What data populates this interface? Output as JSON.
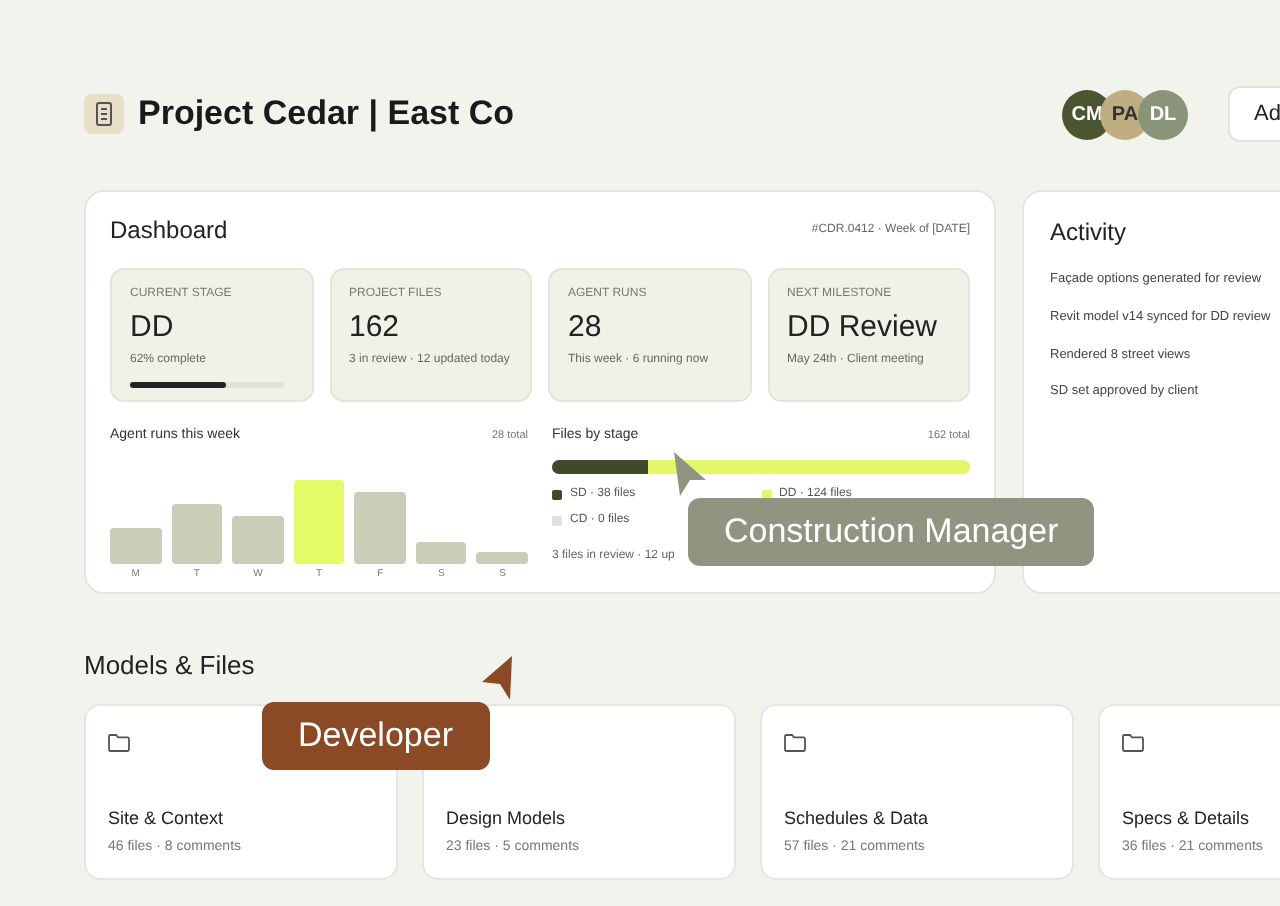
{
  "header": {
    "title": "Project Cedar | East Co",
    "avatars": [
      {
        "initials": "CM",
        "color": "#4b5532"
      },
      {
        "initials": "PA",
        "color": "#bfae82"
      },
      {
        "initials": "DL",
        "color": "#8a9478"
      }
    ],
    "button": "Ad"
  },
  "dashboard": {
    "title": "Dashboard",
    "meta": "#CDR.0412 · Week of [DATE]",
    "stats": [
      {
        "label": "CURRENT STAGE",
        "value": "DD",
        "sub": "62% complete",
        "level": 0.62
      },
      {
        "label": "PROJECT FILES",
        "value": "162",
        "sub": "3 in review · 12 updated today"
      },
      {
        "label": "AGENT  RUNS",
        "value": "28",
        "sub": "This week · 6 running now"
      },
      {
        "label": "NEXT MILESTONE",
        "value": "DD Review",
        "sub": "May 24th · Client meeting"
      }
    ],
    "runs": {
      "title": "Agent runs this week",
      "total": "28 total",
      "days": [
        {
          "label": "M",
          "selected": false
        },
        {
          "label": "T",
          "selected": false
        },
        {
          "label": "W",
          "selected": false
        },
        {
          "label": "T",
          "selected": true
        },
        {
          "label": "F",
          "selected": false
        },
        {
          "label": "S",
          "selected": false
        },
        {
          "label": "S",
          "selected": false
        }
      ]
    },
    "files": {
      "title": "Files by stage",
      "total": "162 total",
      "stages": [
        {
          "label": "SD · 38 files",
          "color": "#3f4a2a",
          "level": 0.23
        },
        {
          "label": "DD · 124 files",
          "color": "#e4f76a",
          "level": 0.77
        },
        {
          "label": "CD · 0 files",
          "color": "#e2e2dc"
        }
      ],
      "note": "3 files in review · 12 up"
    }
  },
  "activity": {
    "title": "Activity",
    "items": [
      "Façade options generated for review",
      "Revit model v14 synced for DD review",
      "Rendered 8 street views",
      "SD set approved by client"
    ]
  },
  "models": {
    "title": "Models & Files",
    "folders": [
      {
        "name": "Site & Context",
        "meta": "46 files · 8 comments"
      },
      {
        "name": "Design Models",
        "meta": "23 files · 5 comments"
      },
      {
        "name": "Schedules & Data",
        "meta": "57 files · 21 comments"
      },
      {
        "name": "Specs & Details",
        "meta": "36 files · 21 comments"
      }
    ]
  },
  "cursors": [
    {
      "label": "Construction Manager",
      "color": "#8f9580"
    },
    {
      "label": "Developer",
      "color": "#8a4a26"
    }
  ]
}
